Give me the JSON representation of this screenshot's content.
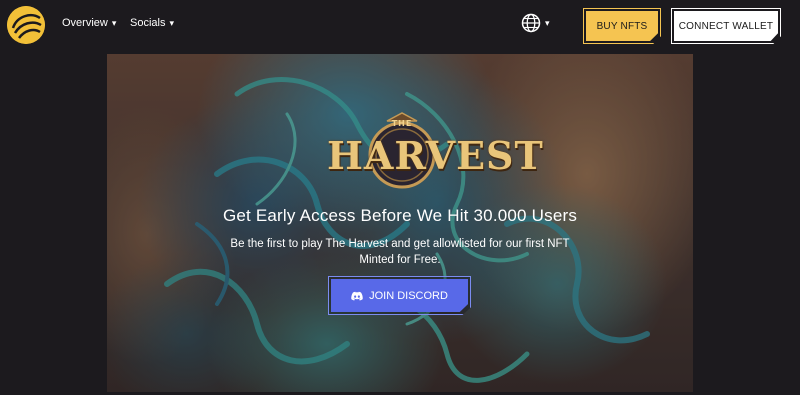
{
  "nav": {
    "logo_icon": "harvest-emblem-icon",
    "items": [
      {
        "label": "Overview",
        "chevron": "▾"
      },
      {
        "label": "Socials",
        "chevron": "▾"
      }
    ],
    "language_icon": "globe-icon",
    "language_chevron": "▾",
    "buy_label": "BUY NFTS",
    "connect_label": "CONNECT WALLET"
  },
  "hero": {
    "logo_the": "THE",
    "logo_title": "HARVEST",
    "heading": "Get Early Access Before We Hit 30.000 Users",
    "subtext": "Be the first to play The Harvest and get allowlisted for our first NFT Minted for Free.",
    "cta_label": "JOIN DISCORD",
    "cta_icon": "discord-icon"
  },
  "colors": {
    "background": "#1c1a1e",
    "accent_yellow": "#f5c451",
    "discord_blue": "#5869e8",
    "logo_gold": "#e9c57a"
  }
}
